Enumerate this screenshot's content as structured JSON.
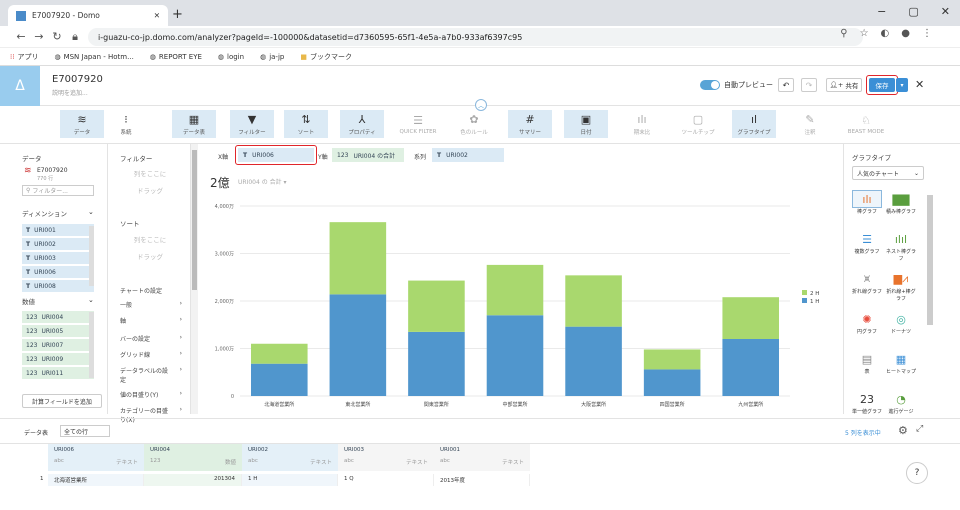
{
  "browser": {
    "tab_title": "E7007920 - Domo",
    "new_tab": "+",
    "url": "i-guazu-co-jp.domo.com/analyzer?pageId=-100000&datasetid=d7360595-65f1-4e5a-a7b0-933af6397c95",
    "bookmarks": [
      "アプリ",
      "MSN Japan - Hotm...",
      "REPORT EYE",
      "login",
      "ja-jp",
      "ブックマーク"
    ]
  },
  "header": {
    "logo": "Δ",
    "title": "E7007920",
    "description": "説明を追加...",
    "autopreview": "自動プレビュー",
    "share": "共有",
    "save": "保存"
  },
  "toolbar": [
    {
      "label": "データ",
      "icon": "≋",
      "hl": true
    },
    {
      "label": "系統",
      "icon": "⁝",
      "hl": false
    },
    {
      "label": "データ表",
      "icon": "▦",
      "hl": true
    },
    {
      "label": "フィルター",
      "icon": "▼",
      "hl": true
    },
    {
      "label": "ソート",
      "icon": "⇅",
      "hl": true
    },
    {
      "label": "プロパティ",
      "icon": "⅄",
      "hl": true
    },
    {
      "label": "QUICK FILTER",
      "icon": "☰",
      "dim": true
    },
    {
      "label": "色のルール",
      "icon": "✿",
      "dim": true
    },
    {
      "label": "サマリー",
      "icon": "#",
      "hl": true
    },
    {
      "label": "日付",
      "icon": "▣",
      "hl": true
    },
    {
      "label": "期末比",
      "icon": "ılı",
      "dim": true
    },
    {
      "label": "ツールチップ",
      "icon": "▢",
      "dim": true
    },
    {
      "label": "グラフタイプ",
      "icon": "ıl",
      "hl": true
    },
    {
      "label": "注釈",
      "icon": "✎",
      "dim": true
    },
    {
      "label": "BEAST MODE",
      "icon": "♘",
      "dim": true
    }
  ],
  "left": {
    "data_label": "データ",
    "dataset_name": "E7007920",
    "dataset_rows": "770 行",
    "filter_placeholder": "フィルター...",
    "dimensions_label": "ディメンション",
    "dimensions": [
      "URI001",
      "URI002",
      "URI003",
      "URI006",
      "URI008"
    ],
    "measures_label": "数値",
    "measures": [
      "URI004",
      "URI005",
      "URI007",
      "URI009",
      "URI011"
    ],
    "calc_button": "計算フィールドを追加"
  },
  "middle": {
    "filter_label": "フィルター",
    "filter_drop": [
      "列をここに",
      "ドラッグ"
    ],
    "sort_label": "ソート",
    "sort_drop": [
      "列をここに",
      "ドラッグ"
    ],
    "chart_settings": "チャートの設定",
    "menu": [
      "一般",
      "軸",
      "バーの設定",
      "グリッド線",
      "データラベルの設定",
      "値の目盛り(Y)",
      "カテゴリーの目盛り(X)"
    ]
  },
  "shelf": {
    "x_label": "X軸",
    "x_field": "URI006",
    "y_label": "Y軸",
    "y_field": "URI004 の合計",
    "series_label": "系列",
    "series_field": "URI002"
  },
  "chart_header": {
    "value": "2億",
    "sub": "URI004 の 合計 ▾"
  },
  "chart_data": {
    "type": "bar",
    "stacked": true,
    "categories": [
      "北海道営業所",
      "東北営業所",
      "関東営業所",
      "中部営業所",
      "大阪営業所",
      "四国営業所",
      "九州営業所"
    ],
    "series": [
      {
        "name": "1 H",
        "color": "#5096cd",
        "values": [
          680,
          2140,
          1350,
          1700,
          1460,
          560,
          1200
        ]
      },
      {
        "name": "2 H",
        "color": "#a9d86e",
        "values": [
          420,
          1520,
          1080,
          1060,
          1080,
          420,
          880
        ]
      }
    ],
    "yticks": [
      "0",
      "1,000万",
      "2,000万",
      "3,000万",
      "4,000万"
    ],
    "ylim": [
      0,
      4000
    ]
  },
  "right": {
    "label": "グラフタイプ",
    "select": "人気のチャート",
    "types": [
      "棒グラフ",
      "積み棒グラフ",
      "複数グラフ",
      "ネスト棒グラフ",
      "折れ線グラフ",
      "折れ線+棒グラフ",
      "円グラフ",
      "ドーナツ",
      "表",
      "ヒートマップ",
      "単一値グラフ",
      "進行ゲージ"
    ]
  },
  "bottom": {
    "label": "データ表",
    "select": "全ての行",
    "columns_link": "5 列を表示中",
    "columns": [
      {
        "name": "URI006",
        "type": "abc",
        "kind": "テキスト",
        "value": "北海道営業所"
      },
      {
        "name": "URI004",
        "type": "123",
        "kind": "数値",
        "value": "201304"
      },
      {
        "name": "URI002",
        "type": "abc",
        "kind": "テキスト",
        "value": "1 H"
      },
      {
        "name": "URI003",
        "type": "abc",
        "kind": "テキスト",
        "value": "1 Q"
      },
      {
        "name": "URI001",
        "type": "abc",
        "kind": "テキスト",
        "value": "2013年度"
      }
    ],
    "row_num": "1"
  }
}
